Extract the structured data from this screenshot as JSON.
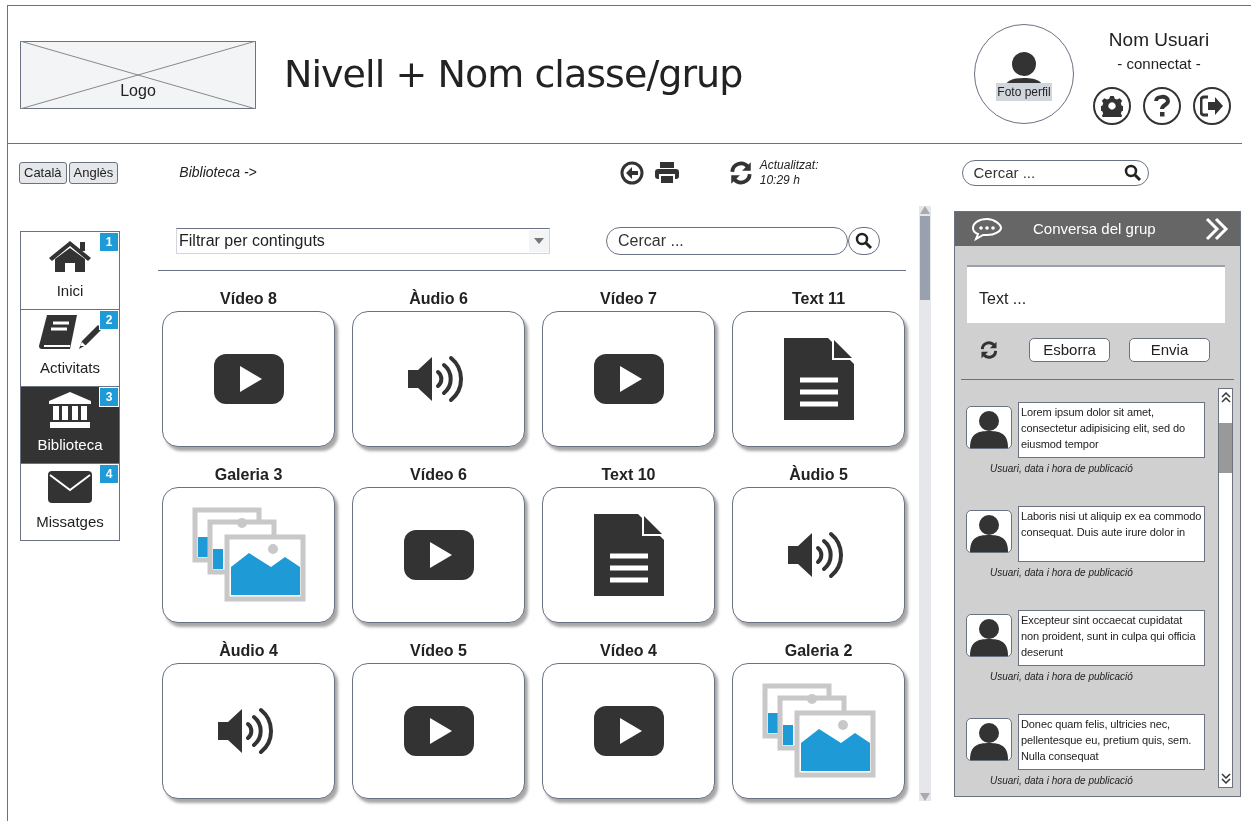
{
  "header": {
    "logo": "Logo",
    "title": "Nivell + Nom classe/grup",
    "profile_photo": "Foto perfil",
    "user_name": "Nom Usuari",
    "user_status": "- connectat -"
  },
  "toolbar": {
    "languages": [
      {
        "label": "Català"
      },
      {
        "label": "Anglès"
      }
    ],
    "breadcrumb": "Biblioteca ->",
    "updated": "Actualitzat:",
    "updated_time": "10:29 h",
    "search": {
      "placeholder": "Cercar ..."
    }
  },
  "nav": [
    {
      "label": "Inici",
      "badge": "1",
      "kind": "home",
      "selected": false
    },
    {
      "label": "Activitats",
      "badge": "2",
      "kind": "activities",
      "selected": false
    },
    {
      "label": "Biblioteca",
      "badge": "3",
      "kind": "library",
      "selected": true
    },
    {
      "label": "Missatges",
      "badge": "4",
      "kind": "messages",
      "selected": false
    }
  ],
  "library": {
    "filter": "Filtrar per continguts",
    "search": {
      "placeholder": "Cercar ..."
    },
    "items": [
      {
        "title": "Vídeo 8",
        "kind": "video"
      },
      {
        "title": "Àudio 6",
        "kind": "audio"
      },
      {
        "title": "Vídeo 7",
        "kind": "video"
      },
      {
        "title": "Text 11",
        "kind": "text"
      },
      {
        "title": "Galeria 3",
        "kind": "gallery"
      },
      {
        "title": "Vídeo 6",
        "kind": "video"
      },
      {
        "title": "Text 10",
        "kind": "text"
      },
      {
        "title": "Àudio 5",
        "kind": "audio"
      },
      {
        "title": "Àudio 4",
        "kind": "audio"
      },
      {
        "title": "Vídeo 5",
        "kind": "video"
      },
      {
        "title": "Vídeo 4",
        "kind": "video"
      },
      {
        "title": "Galeria 2",
        "kind": "gallery"
      }
    ]
  },
  "chat": {
    "title": "Conversa del grup",
    "input": {
      "placeholder": "Text ..."
    },
    "buttons": [
      "Esborra",
      "Envia"
    ],
    "messages": [
      {
        "text": "Lorem ipsum dolor sit amet, consectetur adipisicing elit, sed do eiusmod tempor",
        "meta": "Usuari, data i hora de publicació"
      },
      {
        "text": "Laboris nisi ut aliquip ex ea commodo consequat. Duis aute irure dolor in",
        "meta": "Usuari, data i hora de publicació"
      },
      {
        "text": "Excepteur sint occaecat cupidatat non proident, sunt in culpa qui officia deserunt",
        "meta": "Usuari, data i hora de publicació"
      },
      {
        "text": "Donec quam felis, ultricies nec, pellentesque eu, pretium quis, sem. Nulla consequat",
        "meta": "Usuari, data i hora de publicació"
      }
    ]
  }
}
